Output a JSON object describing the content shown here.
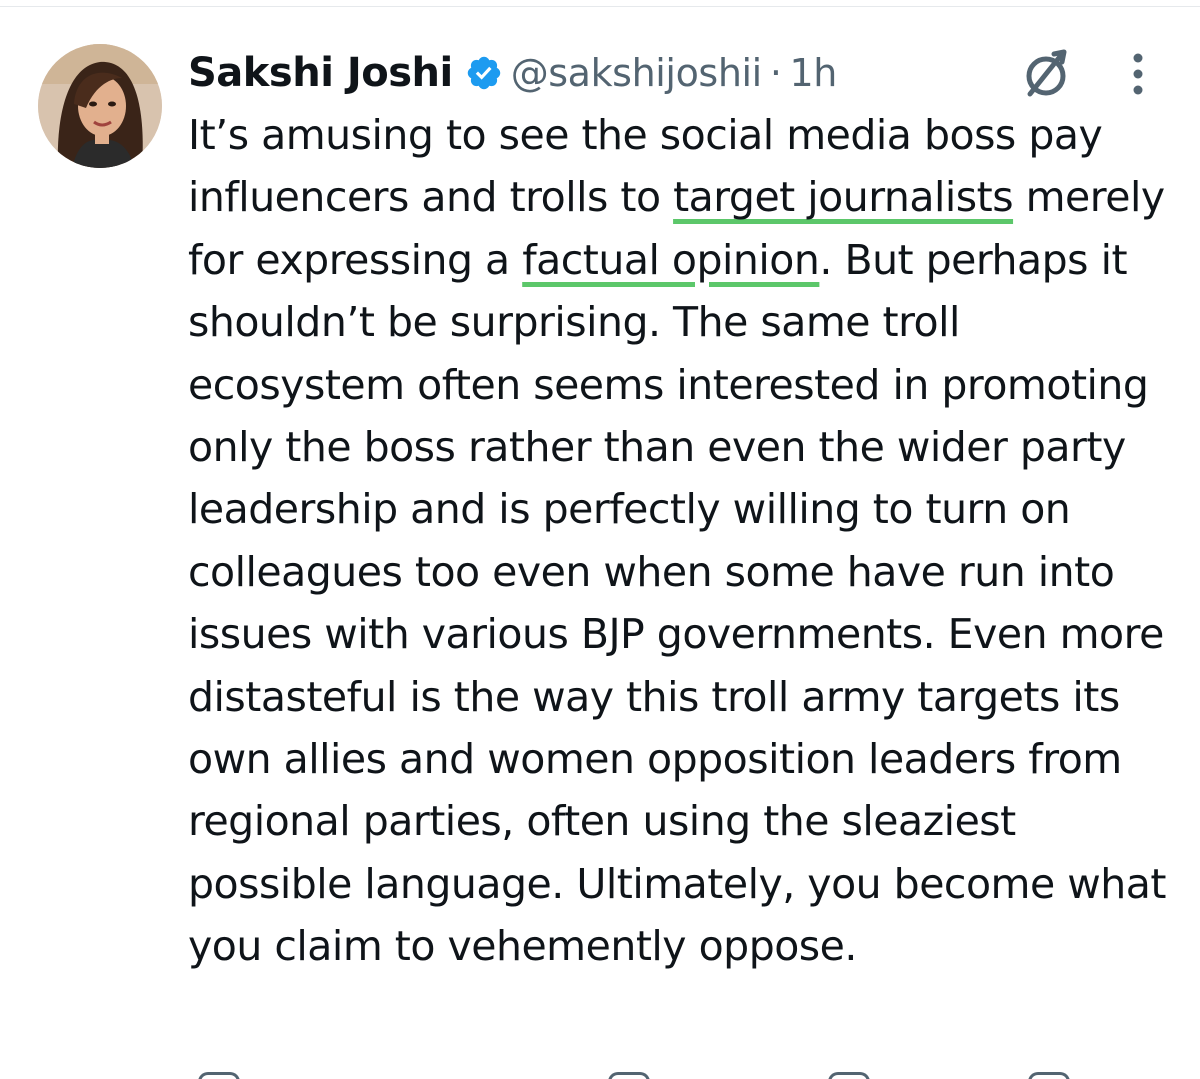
{
  "tweet": {
    "author": {
      "display_name": "Sakshi Joshi",
      "handle": "@sakshijoshii",
      "verified": true
    },
    "separator": "·",
    "time": "1h",
    "text": {
      "part1": "It’s amusing to see the social media boss pay influencers and trolls to ",
      "highlight1": "target journalists",
      "part2": " merely for expressing a ",
      "highlight2": "factual opinion",
      "part3": ". But perhaps it shouldn’t be surprising. The same troll ecosystem often seems interested in promoting only the boss rather than even the wider party leadership and is perfectly willing to turn on colleagues too even when some have run into issues with various BJP governments. Even more distasteful is the way this troll army targets its own allies and women opposition leaders from regional parties, often using the sleaziest possible language. Ultimately, you become what you claim to vehemently oppose."
    }
  },
  "icons": {
    "verified": "verified-badge-icon",
    "grok": "grok-icon",
    "more": "more-options-icon"
  },
  "colors": {
    "verified_blue": "#1d9bf0",
    "highlight_green": "#5cc76a",
    "text_primary": "#0f1419",
    "text_secondary": "#536471"
  }
}
